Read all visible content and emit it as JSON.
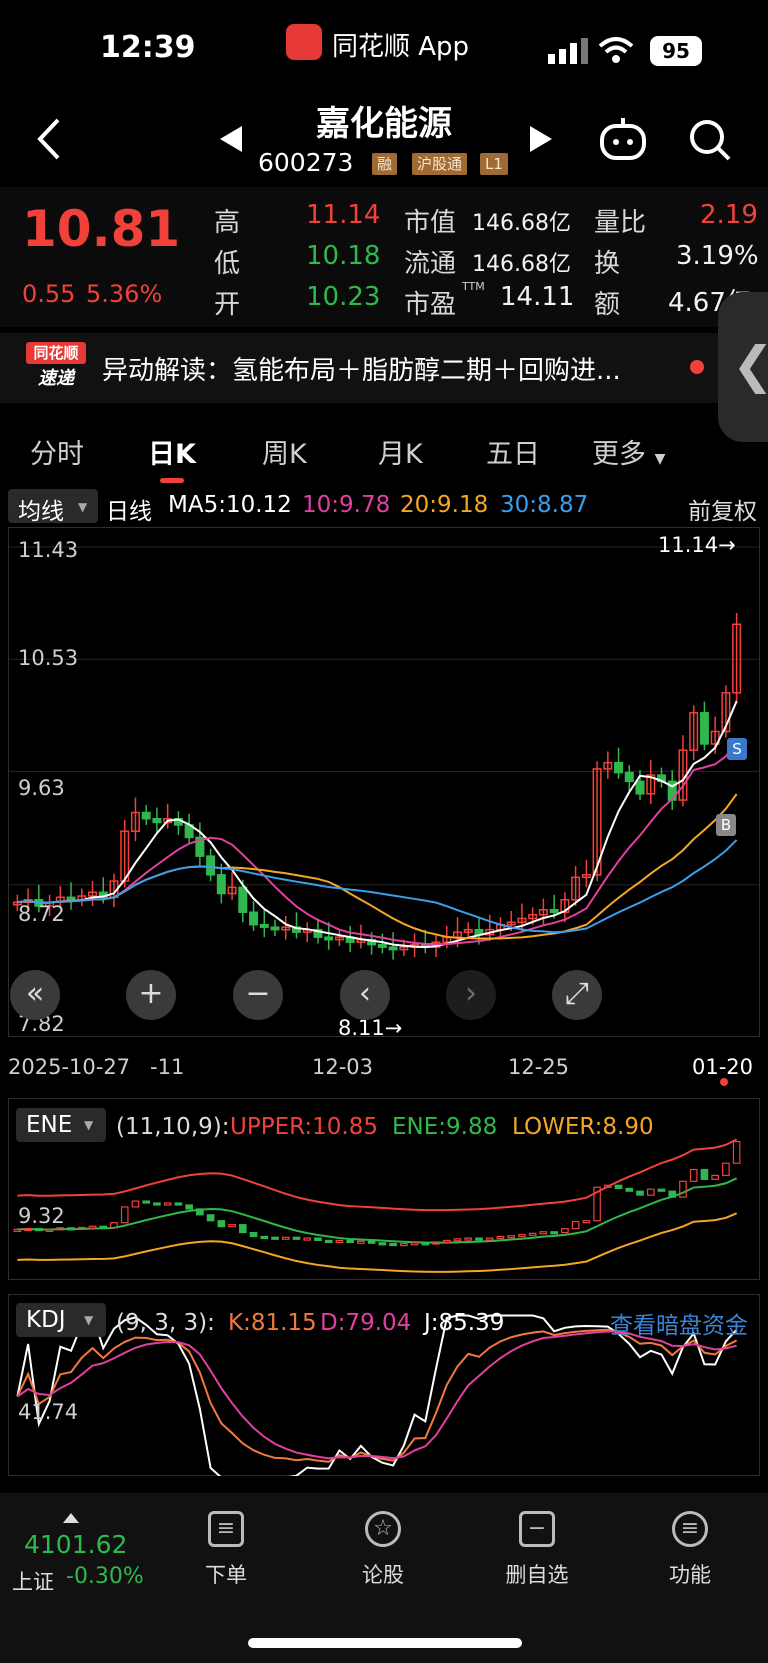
{
  "status": {
    "time": "12:39",
    "app_name": "同花顺 App",
    "battery": "95"
  },
  "header": {
    "name": "嘉化能源",
    "code": "600273",
    "tags": [
      "融",
      "沪股通",
      "L1"
    ]
  },
  "quote": {
    "price": "10.81",
    "change": "0.55",
    "change_pct": "5.36%",
    "high_label": "高",
    "high": "11.14",
    "low_label": "低",
    "low": "10.18",
    "open_label": "开",
    "open": "10.23",
    "mcap_label": "市值",
    "mcap": "146.68亿",
    "float_label": "流通",
    "float": "146.68亿",
    "pe_label": "市盈",
    "pe_sup": "TTM",
    "pe": "14.11",
    "vol_ratio_label": "量比",
    "vol_ratio": "2.19",
    "turnover_label": "换",
    "turnover": "3.19%",
    "amount_label": "额",
    "amount": "4.67亿"
  },
  "news": {
    "logo_top": "同花顺",
    "logo_bottom": "速递",
    "text": "异动解读：氢能布局＋脂肪醇二期＋回购进..."
  },
  "tabs": [
    "分时",
    "日K",
    "周K",
    "月K",
    "五日",
    "更多"
  ],
  "ma_row": {
    "select": "均线",
    "period": "日线",
    "ma5": "MA5:10.12",
    "ma10": "10:9.78",
    "ma20": "20:9.18",
    "ma30": "30:8.87",
    "adjust": "前复权"
  },
  "kline": {
    "price_labels": [
      "11.43",
      "10.53",
      "9.63",
      "8.72",
      "7.82"
    ],
    "max_marker": "11.14→",
    "min_marker": "8.11→",
    "dates": [
      "2025-10-27",
      "-11",
      "12-03",
      "12-25",
      "01-20"
    ],
    "signals": [
      "S",
      "B"
    ]
  },
  "ene": {
    "select": "ENE",
    "params": "(11,10,9):",
    "upper": "UPPER:10.85",
    "mid": "ENE:9.88",
    "lower": "LOWER:8.90",
    "label": "9.32"
  },
  "kdj": {
    "select": "KDJ",
    "params": "(9, 3, 3):",
    "k": "K:81.15",
    "d": "D:79.04",
    "j": "J:85.39",
    "link": "查看暗盘资金",
    "label": "41.74"
  },
  "bottom": {
    "index_value": "4101.62",
    "index_name": "上证",
    "index_change": "-0.30%",
    "nav": [
      "下单",
      "论股",
      "删自选",
      "功能"
    ]
  },
  "colors": {
    "up": "#f0413b",
    "down": "#2fb84d",
    "ma5": "#ffffff",
    "ma10": "#e040a0",
    "ma20": "#f5a623",
    "ma30": "#3a9ee8"
  }
}
